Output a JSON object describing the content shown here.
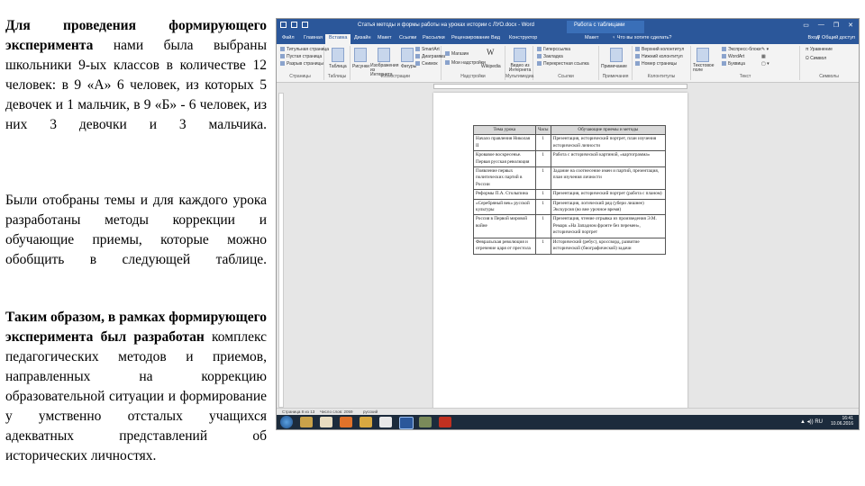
{
  "left_text": {
    "p1_bold": "Для проведения формирующего эксперимента",
    "p1_rest": " нами была выбраны школьники 9-ых классов в количестве 12 человек: в 9 «А» 6 человек, из которых 5 девочек и 1 мальчик, в 9 «Б» - 6 человек, из них 3 девочки и 3 мальчика.",
    "p2": "Были отобраны темы и для каждого урока разработаны методы коррекции и обучающие приемы, которые можно обобщить в следующей таблице.",
    "p3_bold": "Таким образом, в рамках формирующего эксперимента был разработан",
    "p3_rest": " комплекс педагогических методов и приемов, направленных на коррекцию образовательной ситуации и формирование у умственно отсталых учащихся адекватных представлений об исторических личностях."
  },
  "word": {
    "doc_title": "Статья методы и формы работы на уроках истории с ЛУО.docx - Word",
    "context_tab": "Работа с таблицами",
    "window_controls": [
      "▭",
      "—",
      "❐",
      "✕"
    ],
    "tabs": [
      "Файл",
      "Главная",
      "Вставка",
      "Дизайн",
      "Макет",
      "Ссылки",
      "Рассылки",
      "Рецензирование",
      "Вид",
      "Конструктор",
      "Макет"
    ],
    "active_tab_index": 2,
    "tell_me": "♀ Что вы хотите сделать?",
    "login": "Вход",
    "share": "⚲ Общий доступ",
    "ribbon_groups": [
      "Страницы",
      "Таблицы",
      "Иллюстрации",
      "Надстройки",
      "Мультимедиа",
      "Ссылки",
      "Примечания",
      "Колонтитулы",
      "Текст",
      "Символы"
    ],
    "ribbon_items": {
      "pages": [
        "Титульная страница",
        "Пустая страница",
        "Разрыв страницы"
      ],
      "tables": "Таблица",
      "illustrations": [
        "Рисунки",
        "Изображения из Интернета",
        "Фигуры"
      ],
      "smartart": [
        "SmartArt",
        "Диаграмма",
        "Снимок"
      ],
      "addins": [
        "Магазин",
        "Мои надстройки"
      ],
      "wikipedia": "Wikipedia",
      "media": "Видео из Интернета",
      "links": [
        "Гиперссылка",
        "Закладка",
        "Перекрестная ссылка"
      ],
      "comment": "Примечание",
      "header_footer": [
        "Верхний колонтитул",
        "Нижний колонтитул",
        "Номер страницы"
      ],
      "text": [
        "Текстовое поле",
        "Экспресс-блоки",
        "WordArt",
        "Буквица"
      ],
      "symbols": [
        "Уравнение",
        "Символ"
      ]
    },
    "status": {
      "page": "Страница 8 из 13",
      "words": "Число слов: 2059",
      "language": "русский"
    },
    "tray": {
      "time": "16:41",
      "date": "10.06.2016",
      "language": "RU"
    }
  },
  "lesson_table": {
    "headers": [
      "Тема урока",
      "Часы",
      "Обучающие приемы и методы"
    ],
    "rows": [
      [
        "Начало правления Николая II",
        "1",
        "Презентация, исторический портрет, план изучения исторической личности"
      ],
      [
        "Кровавое воскресенье. Первая русская революция",
        "1",
        "Работа с исторической картиной, «картограмма»"
      ],
      [
        "Появление первых политических партий в России",
        "1",
        "Задание на соотнесение имен и партий, презентация, план изучения личности"
      ],
      [
        "Реформы П.А. Столыпина",
        "1",
        "Презентация, исторический портрет (работа с планом)"
      ],
      [
        "«Серебряный век» русской культуры",
        "1",
        "Презентация, логический ряд (убери лишнее) Экскурсия (во вне урочное время)"
      ],
      [
        "Россия в Первой мировой войне",
        "1",
        "Презентация, чтение отрывка из произведения Э.М. Ремарк «На Западном фронте без перемен», исторический портрет"
      ],
      [
        "Февральская революция и отречение царя от престола",
        "1",
        "Исторический (ребус), кроссворд, развитие исторической (биографической) задачи"
      ]
    ]
  }
}
